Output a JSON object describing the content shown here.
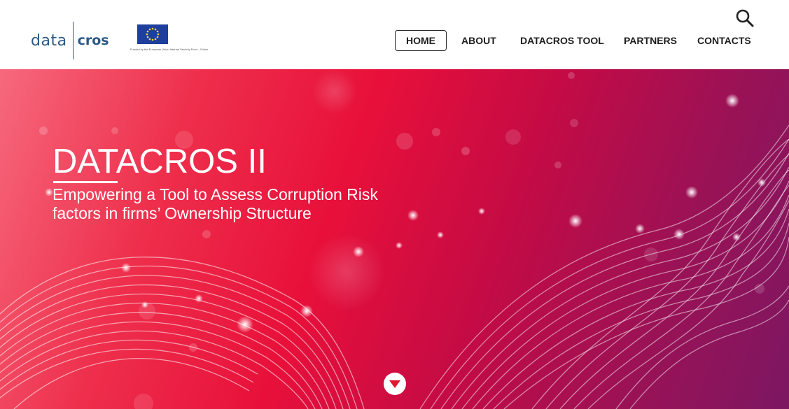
{
  "header": {
    "logo": {
      "left": "data",
      "right": "cros"
    },
    "eu_logo": {
      "caption": "Funded by the European Union Internal Security Fund – Police",
      "icon": "eu-flag"
    },
    "search_icon": "magnifier",
    "nav": [
      {
        "label": "HOME",
        "active": true
      },
      {
        "label": "ABOUT"
      },
      {
        "label": "DATACROS TOOL"
      },
      {
        "label": "PARTNERS"
      },
      {
        "label": "CONTACTS"
      }
    ]
  },
  "hero": {
    "title": "DATACROS II",
    "subtitle_line1": "Empowering a Tool to Assess Corruption Risk",
    "subtitle_line2": "factors in firms’ Ownership Structure",
    "scroll_icon": "chevron-down"
  },
  "colors": {
    "brand": "#2a5a86",
    "hero_start": "#f6697d",
    "hero_mid": "#e8103a",
    "hero_end": "#7c1762",
    "accent": "#e0152f"
  }
}
